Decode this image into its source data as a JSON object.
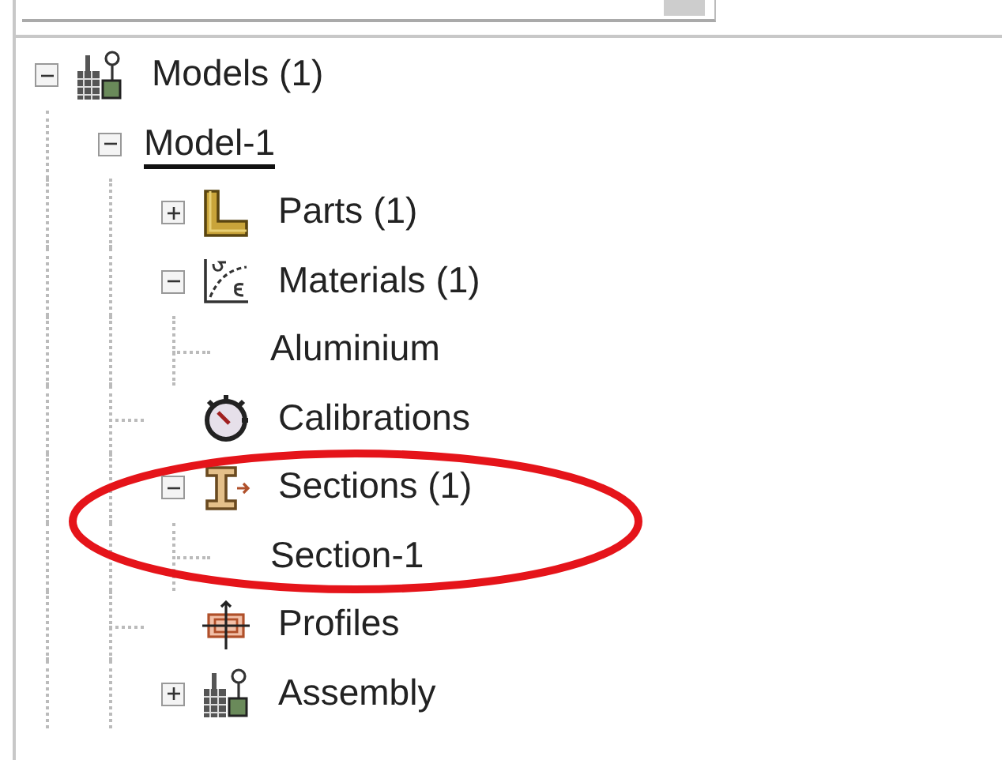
{
  "tree": [
    {
      "label": "Models (1)",
      "kind": "models",
      "expanded": true,
      "selected": false,
      "children": [
        {
          "label": "Model-1",
          "expanded": true,
          "selected": true,
          "children": [
            {
              "label": "Parts (1)",
              "kind": "parts",
              "expanded": false,
              "selected": false
            },
            {
              "label": "Materials (1)",
              "kind": "materials",
              "expanded": true,
              "selected": false,
              "children": [
                {
                  "label": "Aluminium",
                  "selected": false
                }
              ]
            },
            {
              "label": "Calibrations",
              "kind": "calibrations",
              "selected": false
            },
            {
              "label": "Sections (1)",
              "kind": "sections",
              "expanded": true,
              "selected": false,
              "children": [
                {
                  "label": "Section-1",
                  "selected": false
                }
              ]
            },
            {
              "label": "Profiles",
              "kind": "profiles",
              "selected": false
            },
            {
              "label": "Assembly",
              "kind": "assembly",
              "expanded": false,
              "selected": false
            }
          ]
        }
      ]
    }
  ]
}
